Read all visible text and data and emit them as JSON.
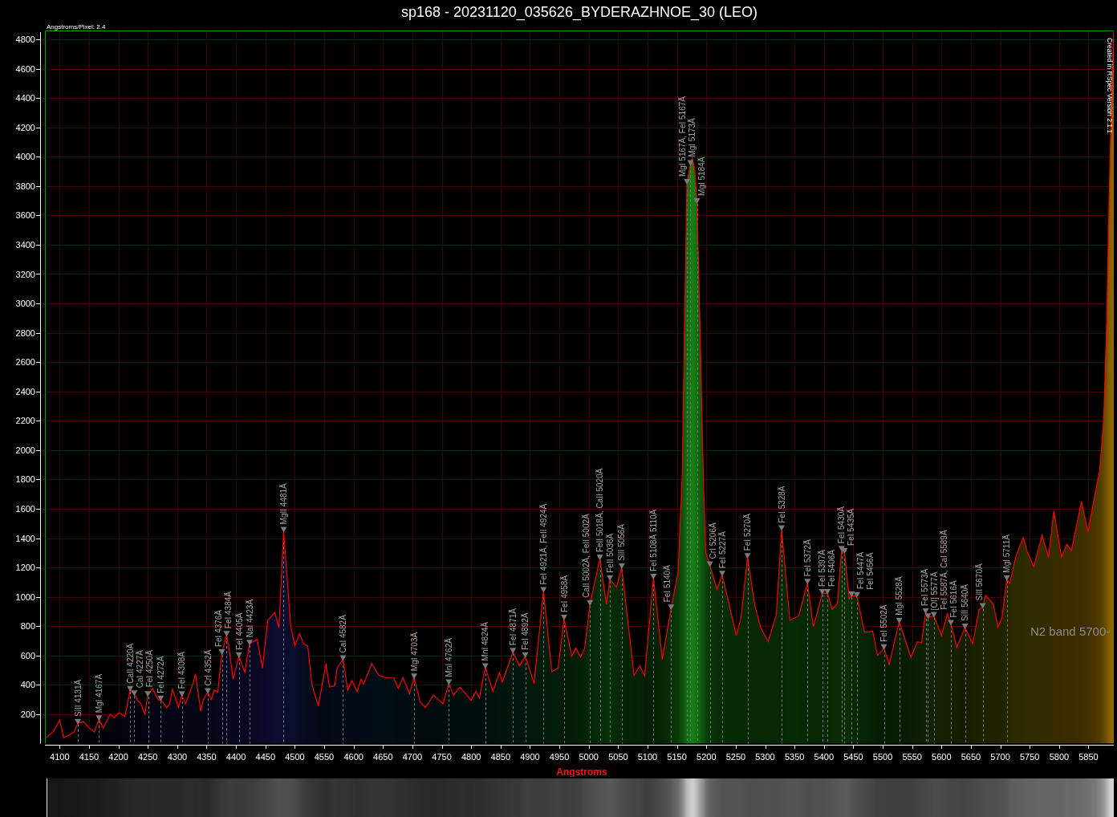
{
  "plot": {
    "scale_note": "Angstroms/Pixel: 2.4",
    "credit": "Created in RSpec Version 2.1.1",
    "chart_data": {
      "type": "area",
      "title": "sp168 - 20231120_035626_BYDERAZHNOE_30 (LEO)",
      "xlabel": "Angstroms",
      "grid": true,
      "x": [
        4077,
        4089,
        4100,
        4107,
        4115,
        4125,
        4131,
        4141,
        4149,
        4159,
        4167,
        4174,
        4186,
        4193,
        4201,
        4211,
        4220,
        4227,
        4234,
        4238,
        4245,
        4250,
        4258,
        4268,
        4272,
        4282,
        4287,
        4292,
        4302,
        4308,
        4314,
        4327,
        4331,
        4340,
        4344,
        4352,
        4358,
        4363,
        4369,
        4376,
        4384,
        4389,
        4395,
        4405,
        4415,
        4423,
        4436,
        4445,
        4454,
        4466,
        4473,
        4481,
        4493,
        4500,
        4508,
        4515,
        4522,
        4529,
        4540,
        4553,
        4559,
        4568,
        4572,
        4582,
        4590,
        4597,
        4606,
        4613,
        4617,
        4631,
        4643,
        4654,
        4668,
        4676,
        4684,
        4695,
        4703,
        4713,
        4722,
        4736,
        4752,
        4762,
        4770,
        4781,
        4800,
        4808,
        4814,
        4824,
        4837,
        4848,
        4853,
        4871,
        4882,
        4892,
        4907,
        4923,
        4937,
        4948,
        4958,
        4971,
        4978,
        4986,
        4993,
        5002,
        5019,
        5030,
        5036,
        5047,
        5056,
        5077,
        5087,
        5095,
        5110,
        5125,
        5140,
        5152,
        5159,
        5163,
        5167,
        5173,
        5176,
        5180,
        5184,
        5189,
        5195,
        5199,
        5206,
        5218,
        5227,
        5251,
        5259,
        5270,
        5282,
        5292,
        5305,
        5319,
        5328,
        5342,
        5357,
        5372,
        5382,
        5391,
        5397,
        5406,
        5414,
        5423,
        5430,
        5435,
        5443,
        5447,
        5456,
        5469,
        5483,
        5491,
        5502,
        5511,
        5528,
        5548,
        5559,
        5566,
        5573,
        5577,
        5587,
        5600,
        5610,
        5616,
        5626,
        5634,
        5640,
        5653,
        5664,
        5670,
        5675,
        5688,
        5696,
        5703,
        5711,
        5716,
        5726,
        5739,
        5746,
        5757,
        5771,
        5782,
        5791,
        5804,
        5813,
        5821,
        5838,
        5849,
        5862,
        5869,
        5876,
        5881,
        5885,
        5890,
        5893
      ],
      "series": [
        {
          "color": "#ff0000",
          "values": [
            40,
            80,
            160,
            40,
            55,
            80,
            140,
            150,
            110,
            80,
            165,
            105,
            200,
            175,
            210,
            185,
            365,
            335,
            285,
            275,
            200,
            330,
            375,
            295,
            300,
            245,
            270,
            370,
            245,
            330,
            270,
            410,
            475,
            220,
            295,
            350,
            300,
            365,
            350,
            615,
            740,
            625,
            440,
            595,
            485,
            680,
            710,
            515,
            840,
            895,
            790,
            1450,
            805,
            665,
            750,
            680,
            665,
            405,
            255,
            545,
            385,
            395,
            515,
            575,
            365,
            430,
            355,
            440,
            405,
            545,
            465,
            450,
            450,
            375,
            450,
            340,
            450,
            285,
            245,
            330,
            270,
            410,
            330,
            385,
            295,
            355,
            310,
            520,
            355,
            485,
            420,
            625,
            530,
            595,
            410,
            1040,
            490,
            515,
            850,
            595,
            650,
            590,
            650,
            950,
            1260,
            950,
            1120,
            1065,
            1200,
            465,
            530,
            460,
            1130,
            575,
            920,
            1170,
            1830,
            2880,
            3820,
            3950,
            3990,
            3920,
            3690,
            2880,
            1790,
            1300,
            1215,
            1050,
            1150,
            735,
            860,
            1270,
            950,
            795,
            695,
            875,
            1460,
            840,
            870,
            1095,
            795,
            930,
            1025,
            1025,
            915,
            955,
            1320,
            1305,
            985,
            1010,
            1005,
            760,
            765,
            600,
            650,
            540,
            830,
            585,
            695,
            685,
            895,
            860,
            870,
            735,
            885,
            815,
            655,
            735,
            790,
            680,
            915,
            930,
            1010,
            950,
            795,
            860,
            1120,
            1090,
            1270,
            1405,
            1305,
            1205,
            1420,
            1270,
            1585,
            1270,
            1360,
            1315,
            1650,
            1445,
            1720,
            1860,
            2225,
            2880,
            3700,
            4520,
            4860
          ]
        },
        {
          "type": "scatter",
          "color": "#7a7a7a",
          "values": [
            null,
            null,
            null,
            null,
            null,
            null,
            140,
            null,
            null,
            null,
            165,
            null,
            null,
            null,
            null,
            null,
            365,
            335,
            null,
            null,
            null,
            330,
            null,
            null,
            300,
            null,
            null,
            null,
            null,
            330,
            null,
            null,
            null,
            null,
            null,
            350,
            null,
            null,
            null,
            615,
            740,
            null,
            null,
            595,
            null,
            680,
            null,
            null,
            null,
            null,
            null,
            1450,
            null,
            null,
            null,
            null,
            null,
            null,
            null,
            null,
            null,
            null,
            null,
            575,
            null,
            null,
            null,
            null,
            null,
            null,
            null,
            null,
            null,
            null,
            null,
            null,
            450,
            null,
            null,
            null,
            null,
            410,
            null,
            null,
            null,
            null,
            null,
            520,
            null,
            null,
            null,
            625,
            null,
            595,
            null,
            1040,
            null,
            null,
            850,
            null,
            null,
            null,
            null,
            950,
            1260,
            null,
            1120,
            null,
            1200,
            null,
            null,
            null,
            1130,
            null,
            920,
            null,
            null,
            null,
            3820,
            3950,
            null,
            null,
            3690,
            null,
            null,
            null,
            1215,
            null,
            1150,
            null,
            null,
            1270,
            null,
            null,
            null,
            null,
            1460,
            null,
            null,
            1095,
            null,
            null,
            1025,
            1025,
            null,
            null,
            1320,
            1305,
            null,
            1010,
            1005,
            null,
            null,
            null,
            650,
            null,
            830,
            null,
            null,
            null,
            895,
            860,
            870,
            null,
            null,
            815,
            null,
            null,
            790,
            null,
            null,
            930,
            null,
            null,
            null,
            null,
            1120,
            null,
            null,
            null,
            null,
            null,
            null,
            null,
            null,
            null,
            null,
            null,
            null,
            null,
            null,
            null,
            null,
            null,
            null,
            null,
            null
          ]
        }
      ],
      "xlim": [
        4075,
        5893
      ],
      "ylim": [
        0,
        4860
      ],
      "xticks": [
        4100,
        4150,
        4200,
        4250,
        4300,
        4350,
        4400,
        4450,
        4500,
        4550,
        4600,
        4650,
        4700,
        4750,
        4800,
        4850,
        4900,
        4950,
        5000,
        5050,
        5100,
        5150,
        5200,
        5250,
        5300,
        5350,
        5400,
        5450,
        5500,
        5550,
        5600,
        5650,
        5700,
        5750,
        5800,
        5850
      ],
      "yticks": [
        200,
        400,
        600,
        800,
        1000,
        1200,
        1400,
        1600,
        1800,
        2000,
        2200,
        2400,
        2600,
        2800,
        3000,
        3200,
        3400,
        3600,
        3800,
        4000,
        4200,
        4400,
        4600,
        4800
      ],
      "ref_lines": [
        {
          "axis": "x",
          "value": 4131,
          "label": "SiII 4131Ä"
        },
        {
          "axis": "x",
          "value": 4167,
          "label": "MgI 4167Ä"
        },
        {
          "axis": "x",
          "value": 4220,
          "label": "CaII 4220Ä"
        },
        {
          "axis": "x",
          "value": 4227,
          "label": "CaI 4227Ä"
        },
        {
          "axis": "x",
          "value": 4250,
          "label": "FeI 4250Ä"
        },
        {
          "axis": "x",
          "value": 4272,
          "label": "FeI 4272Ä"
        },
        {
          "axis": "x",
          "value": 4308,
          "label": "FeI 4308Ä"
        },
        {
          "axis": "x",
          "value": 4352,
          "label": "CrI 4352Ä"
        },
        {
          "axis": "x",
          "value": 4376,
          "label": "FeI 4376Ä"
        },
        {
          "axis": "x",
          "value": 4384,
          "label": "FeI 4384Ä"
        },
        {
          "axis": "x",
          "value": 4405,
          "label": "FeI 4405Ä"
        },
        {
          "axis": "x",
          "value": 4423,
          "label": "NaI 4423Ä"
        },
        {
          "axis": "x",
          "value": 4481,
          "label": "MgII 4481Ä"
        },
        {
          "axis": "x",
          "value": 4582,
          "label": "CaI 4582Ä"
        },
        {
          "axis": "x",
          "value": 4703,
          "label": "MgI 4703Ä"
        },
        {
          "axis": "x",
          "value": 4762,
          "label": "MnI 4762Ä"
        },
        {
          "axis": "x",
          "value": 4824,
          "label": "MnI 4824Ä"
        },
        {
          "axis": "x",
          "value": 4871,
          "label": "FeI 4871Ä"
        },
        {
          "axis": "x",
          "value": 4892,
          "label": "FeI 4892Ä"
        },
        {
          "axis": "x",
          "value": 4923,
          "label": "FeI 4921Ä, FeII 4924Ä"
        },
        {
          "axis": "x",
          "value": 4958,
          "label": "FeI 4958Ä"
        },
        {
          "axis": "x",
          "value": 5002,
          "label": "CaII 5002Ä, FeII 5002Ä"
        },
        {
          "axis": "x",
          "value": 5019,
          "label": "FeII 5018Ä, CaII 5020Ä"
        },
        {
          "axis": "x",
          "value": 5036,
          "label": "FeII 5036Ä"
        },
        {
          "axis": "x",
          "value": 5056,
          "label": "SiII 5056Ä"
        },
        {
          "axis": "x",
          "value": 5110,
          "label": "FeI 5108Ä 5110Ä"
        },
        {
          "axis": "x",
          "value": 5140,
          "label": "FeI 5140Ä"
        },
        {
          "axis": "x",
          "value": 5167,
          "label": "MgI 5167Ä, FeI 5167Ä"
        },
        {
          "axis": "x",
          "value": 5173,
          "label": "MgI 5173Ä"
        },
        {
          "axis": "x",
          "value": 5184,
          "label": "MgI 5184Ä"
        },
        {
          "axis": "x",
          "value": 5206,
          "label": "CrI 5206Ä"
        },
        {
          "axis": "x",
          "value": 5227,
          "label": "FeI 5227Ä"
        },
        {
          "axis": "x",
          "value": 5270,
          "label": "FeI 5270Ä"
        },
        {
          "axis": "x",
          "value": 5328,
          "label": "FeI 5328Ä"
        },
        {
          "axis": "x",
          "value": 5372,
          "label": "FeI 5372Ä"
        },
        {
          "axis": "x",
          "value": 5397,
          "label": "FeI 5397Ä"
        },
        {
          "axis": "x",
          "value": 5406,
          "label": "FeI 5406Ä"
        },
        {
          "axis": "x",
          "value": 5430,
          "label": "FeI 5430Ä"
        },
        {
          "axis": "x",
          "value": 5435,
          "label": "FeI 5435Ä"
        },
        {
          "axis": "x",
          "value": 5447,
          "label": "FeI 5447Ä"
        },
        {
          "axis": "x",
          "value": 5456,
          "label": "FeI 5456Ä"
        },
        {
          "axis": "x",
          "value": 5502,
          "label": "FeI 5502Ä"
        },
        {
          "axis": "x",
          "value": 5528,
          "label": "MgI 5528Ä"
        },
        {
          "axis": "x",
          "value": 5573,
          "label": "FeI 5573Ä"
        },
        {
          "axis": "x",
          "value": 5577,
          "label": "[OI] 5577Ä"
        },
        {
          "axis": "x",
          "value": 5587,
          "label": "FeI 5587Ä, CaI 5589Ä"
        },
        {
          "axis": "x",
          "value": 5616,
          "label": "FeI 5616Ä"
        },
        {
          "axis": "x",
          "value": 5640,
          "label": "SiII 5640Ä"
        },
        {
          "axis": "x",
          "value": 5670,
          "label": "SiII 5670Ä"
        },
        {
          "axis": "x",
          "value": 5711,
          "label": "MgI 5711Ä"
        }
      ],
      "annotations": [
        "N2 band 5700-"
      ]
    }
  }
}
